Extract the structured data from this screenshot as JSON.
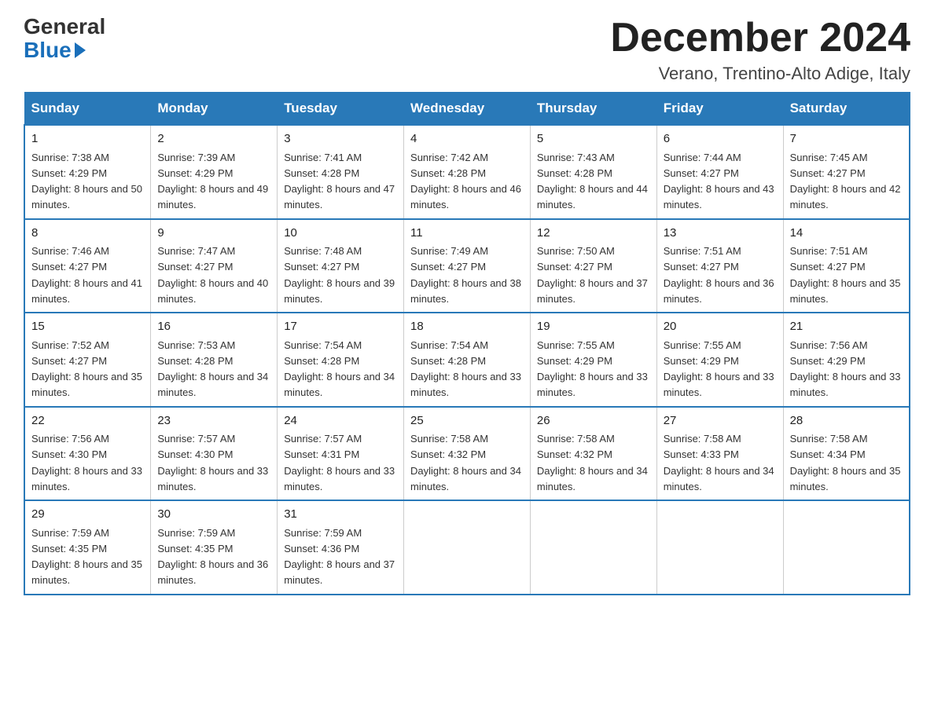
{
  "logo": {
    "general": "General",
    "blue": "Blue"
  },
  "title": "December 2024",
  "subtitle": "Verano, Trentino-Alto Adige, Italy",
  "headers": [
    "Sunday",
    "Monday",
    "Tuesday",
    "Wednesday",
    "Thursday",
    "Friday",
    "Saturday"
  ],
  "weeks": [
    [
      {
        "day": "1",
        "sunrise": "7:38 AM",
        "sunset": "4:29 PM",
        "daylight": "8 hours and 50 minutes."
      },
      {
        "day": "2",
        "sunrise": "7:39 AM",
        "sunset": "4:29 PM",
        "daylight": "8 hours and 49 minutes."
      },
      {
        "day": "3",
        "sunrise": "7:41 AM",
        "sunset": "4:28 PM",
        "daylight": "8 hours and 47 minutes."
      },
      {
        "day": "4",
        "sunrise": "7:42 AM",
        "sunset": "4:28 PM",
        "daylight": "8 hours and 46 minutes."
      },
      {
        "day": "5",
        "sunrise": "7:43 AM",
        "sunset": "4:28 PM",
        "daylight": "8 hours and 44 minutes."
      },
      {
        "day": "6",
        "sunrise": "7:44 AM",
        "sunset": "4:27 PM",
        "daylight": "8 hours and 43 minutes."
      },
      {
        "day": "7",
        "sunrise": "7:45 AM",
        "sunset": "4:27 PM",
        "daylight": "8 hours and 42 minutes."
      }
    ],
    [
      {
        "day": "8",
        "sunrise": "7:46 AM",
        "sunset": "4:27 PM",
        "daylight": "8 hours and 41 minutes."
      },
      {
        "day": "9",
        "sunrise": "7:47 AM",
        "sunset": "4:27 PM",
        "daylight": "8 hours and 40 minutes."
      },
      {
        "day": "10",
        "sunrise": "7:48 AM",
        "sunset": "4:27 PM",
        "daylight": "8 hours and 39 minutes."
      },
      {
        "day": "11",
        "sunrise": "7:49 AM",
        "sunset": "4:27 PM",
        "daylight": "8 hours and 38 minutes."
      },
      {
        "day": "12",
        "sunrise": "7:50 AM",
        "sunset": "4:27 PM",
        "daylight": "8 hours and 37 minutes."
      },
      {
        "day": "13",
        "sunrise": "7:51 AM",
        "sunset": "4:27 PM",
        "daylight": "8 hours and 36 minutes."
      },
      {
        "day": "14",
        "sunrise": "7:51 AM",
        "sunset": "4:27 PM",
        "daylight": "8 hours and 35 minutes."
      }
    ],
    [
      {
        "day": "15",
        "sunrise": "7:52 AM",
        "sunset": "4:27 PM",
        "daylight": "8 hours and 35 minutes."
      },
      {
        "day": "16",
        "sunrise": "7:53 AM",
        "sunset": "4:28 PM",
        "daylight": "8 hours and 34 minutes."
      },
      {
        "day": "17",
        "sunrise": "7:54 AM",
        "sunset": "4:28 PM",
        "daylight": "8 hours and 34 minutes."
      },
      {
        "day": "18",
        "sunrise": "7:54 AM",
        "sunset": "4:28 PM",
        "daylight": "8 hours and 33 minutes."
      },
      {
        "day": "19",
        "sunrise": "7:55 AM",
        "sunset": "4:29 PM",
        "daylight": "8 hours and 33 minutes."
      },
      {
        "day": "20",
        "sunrise": "7:55 AM",
        "sunset": "4:29 PM",
        "daylight": "8 hours and 33 minutes."
      },
      {
        "day": "21",
        "sunrise": "7:56 AM",
        "sunset": "4:29 PM",
        "daylight": "8 hours and 33 minutes."
      }
    ],
    [
      {
        "day": "22",
        "sunrise": "7:56 AM",
        "sunset": "4:30 PM",
        "daylight": "8 hours and 33 minutes."
      },
      {
        "day": "23",
        "sunrise": "7:57 AM",
        "sunset": "4:30 PM",
        "daylight": "8 hours and 33 minutes."
      },
      {
        "day": "24",
        "sunrise": "7:57 AM",
        "sunset": "4:31 PM",
        "daylight": "8 hours and 33 minutes."
      },
      {
        "day": "25",
        "sunrise": "7:58 AM",
        "sunset": "4:32 PM",
        "daylight": "8 hours and 34 minutes."
      },
      {
        "day": "26",
        "sunrise": "7:58 AM",
        "sunset": "4:32 PM",
        "daylight": "8 hours and 34 minutes."
      },
      {
        "day": "27",
        "sunrise": "7:58 AM",
        "sunset": "4:33 PM",
        "daylight": "8 hours and 34 minutes."
      },
      {
        "day": "28",
        "sunrise": "7:58 AM",
        "sunset": "4:34 PM",
        "daylight": "8 hours and 35 minutes."
      }
    ],
    [
      {
        "day": "29",
        "sunrise": "7:59 AM",
        "sunset": "4:35 PM",
        "daylight": "8 hours and 35 minutes."
      },
      {
        "day": "30",
        "sunrise": "7:59 AM",
        "sunset": "4:35 PM",
        "daylight": "8 hours and 36 minutes."
      },
      {
        "day": "31",
        "sunrise": "7:59 AM",
        "sunset": "4:36 PM",
        "daylight": "8 hours and 37 minutes."
      },
      null,
      null,
      null,
      null
    ]
  ]
}
